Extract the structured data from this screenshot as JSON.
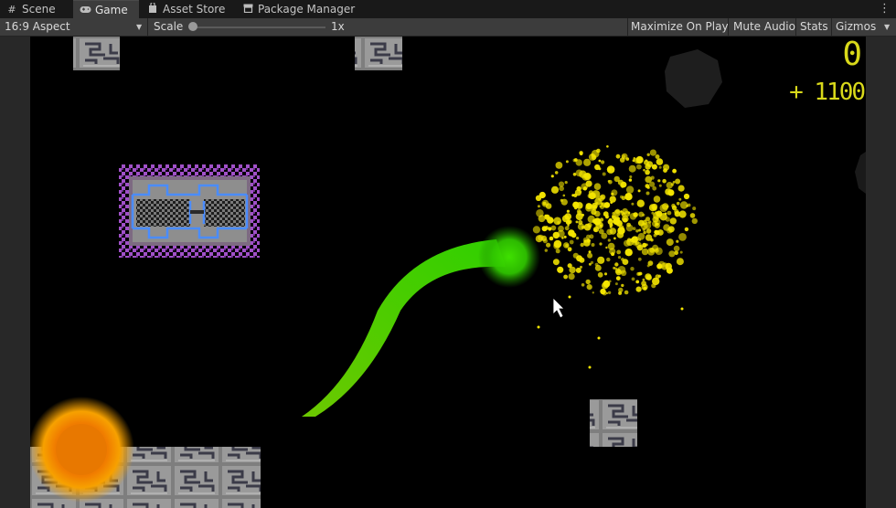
{
  "tabs": [
    {
      "label": "Scene",
      "icon": "grid-icon"
    },
    {
      "label": "Game",
      "icon": "gamepad-icon"
    },
    {
      "label": "Asset Store",
      "icon": "store-icon"
    },
    {
      "label": "Package Manager",
      "icon": "package-icon"
    }
  ],
  "toolbar": {
    "aspect": "16:9 Aspect",
    "scale_label": "Scale",
    "scale_value": "1x",
    "scale_fraction": 0,
    "maximize_label": "Maximize On Play",
    "mute_label": "Mute Audio",
    "stats_label": "Stats",
    "gizmos_label": "Gizmos"
  },
  "game": {
    "score": "0",
    "bonus": "+ 1100",
    "colors": {
      "score": "#d9d91a",
      "player_trail": "#3fe000",
      "burst": "#f5e600",
      "orb": "#f7a100",
      "block": "#8a8a8a",
      "glow_frame": "#a050c8",
      "circuit": "#4a8cff"
    }
  }
}
